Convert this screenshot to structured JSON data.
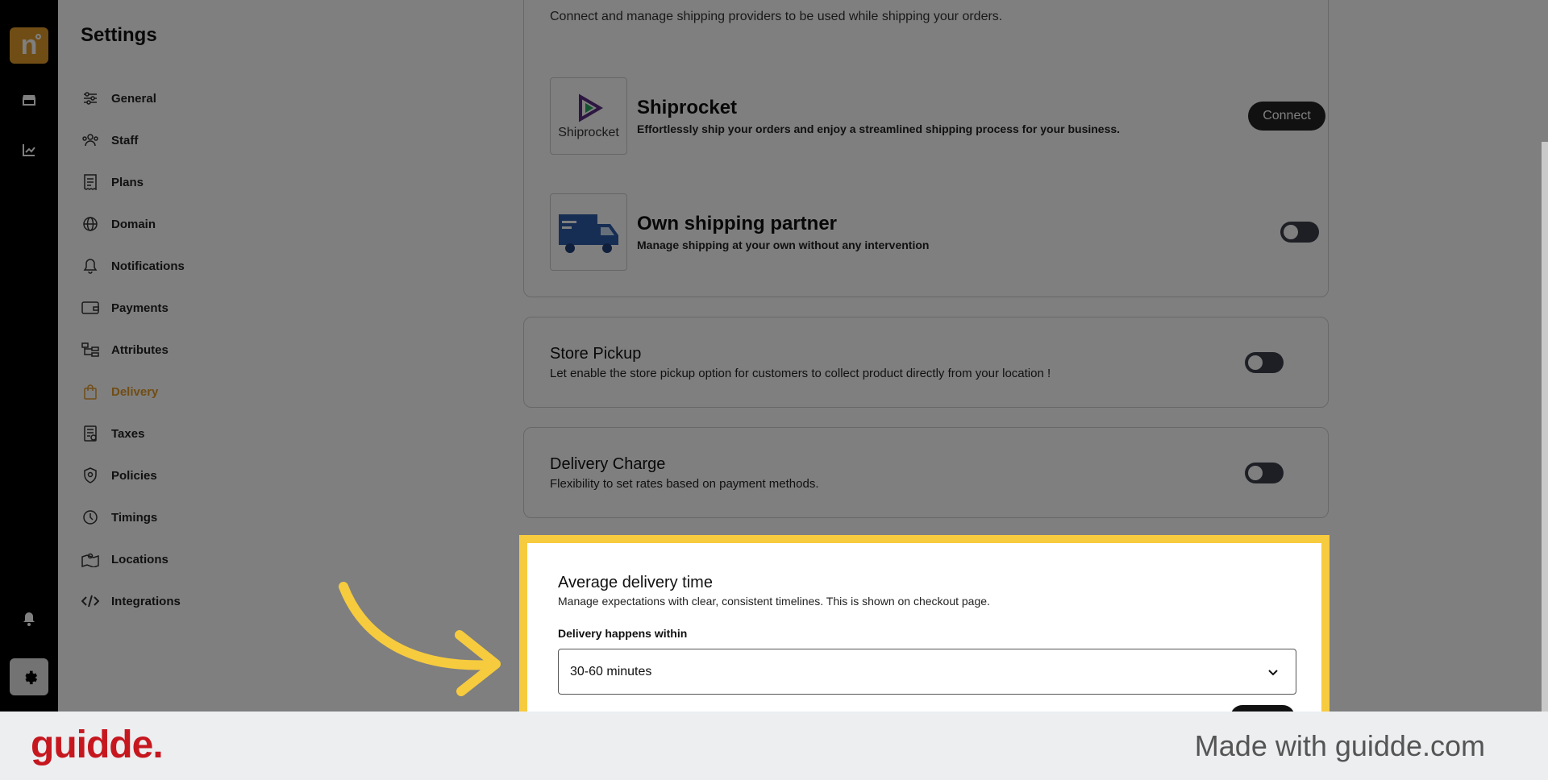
{
  "rail": {
    "logo_letter": "n",
    "icons": [
      "store-icon",
      "chart-line-icon",
      "bell-icon",
      "gear-icon"
    ]
  },
  "sidebar": {
    "title": "Settings",
    "items": [
      {
        "label": "General",
        "icon": "sliders-icon"
      },
      {
        "label": "Staff",
        "icon": "users-icon"
      },
      {
        "label": "Plans",
        "icon": "receipt-icon"
      },
      {
        "label": "Domain",
        "icon": "globe-icon"
      },
      {
        "label": "Notifications",
        "icon": "bell-icon"
      },
      {
        "label": "Payments",
        "icon": "wallet-icon"
      },
      {
        "label": "Attributes",
        "icon": "hierarchy-icon"
      },
      {
        "label": "Delivery",
        "icon": "bag-icon",
        "active": true
      },
      {
        "label": "Taxes",
        "icon": "tax-receipt-icon"
      },
      {
        "label": "Policies",
        "icon": "shield-icon"
      },
      {
        "label": "Timings",
        "icon": "clock-icon"
      },
      {
        "label": "Locations",
        "icon": "map-icon"
      },
      {
        "label": "Integrations",
        "icon": "code-icon"
      }
    ]
  },
  "shipping": {
    "subtitle": "Connect and manage shipping providers to be used while shipping your orders.",
    "providers": [
      {
        "logo_text": "Shiprocket",
        "title": "Shiprocket",
        "description": "Effortlessly ship your orders and enjoy a streamlined shipping process for your business.",
        "action_label": "Connect"
      },
      {
        "title": "Own shipping partner",
        "description": "Manage shipping at your own without any intervention",
        "toggle_on": false
      }
    ]
  },
  "store_pickup": {
    "title": "Store Pickup",
    "description": "Let enable the store pickup option for customers to collect product directly from your location !",
    "toggle_on": false
  },
  "delivery_charge": {
    "title": "Delivery Charge",
    "description": "Flexibility to set rates based on payment methods.",
    "toggle_on": false
  },
  "avg_delivery": {
    "title": "Average delivery time",
    "description": "Manage expectations with clear, consistent timelines. This is shown on checkout page.",
    "field_label": "Delivery happens within",
    "selected_value": "30-60 minutes"
  },
  "colors": {
    "accent": "#e19b2b",
    "highlight": "#f7cb3e",
    "brand": "#c6171f"
  },
  "footer": {
    "brand": "guidde.",
    "tagline": "Made with guidde.com"
  }
}
